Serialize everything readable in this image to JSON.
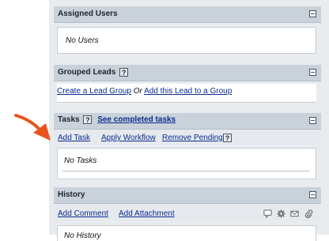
{
  "assigned_users": {
    "title": "Assigned Users",
    "empty_text": "No Users"
  },
  "grouped_leads": {
    "title": "Grouped Leads",
    "help": "?",
    "create_link": "Create a Lead Group",
    "or_text": "Or",
    "add_link": "Add this Lead to a Group"
  },
  "tasks": {
    "title": "Tasks",
    "help": "?",
    "completed_link": "See completed tasks",
    "actions": {
      "add_task": "Add Task",
      "apply_workflow": "Apply Workflow",
      "remove_pending": "Remove Pending",
      "help": "?"
    },
    "empty_text": "No Tasks"
  },
  "history": {
    "title": "History",
    "add_comment": "Add Comment",
    "add_attachment": "Add Attachment",
    "empty_text": "No History",
    "toolbar_icons": [
      "comment-icon",
      "gear-icon",
      "mail-icon",
      "attachment-icon"
    ]
  },
  "colors": {
    "header_bg": "#c9d2da",
    "link": "#0c2b8e",
    "arrow": "#e8541e"
  }
}
